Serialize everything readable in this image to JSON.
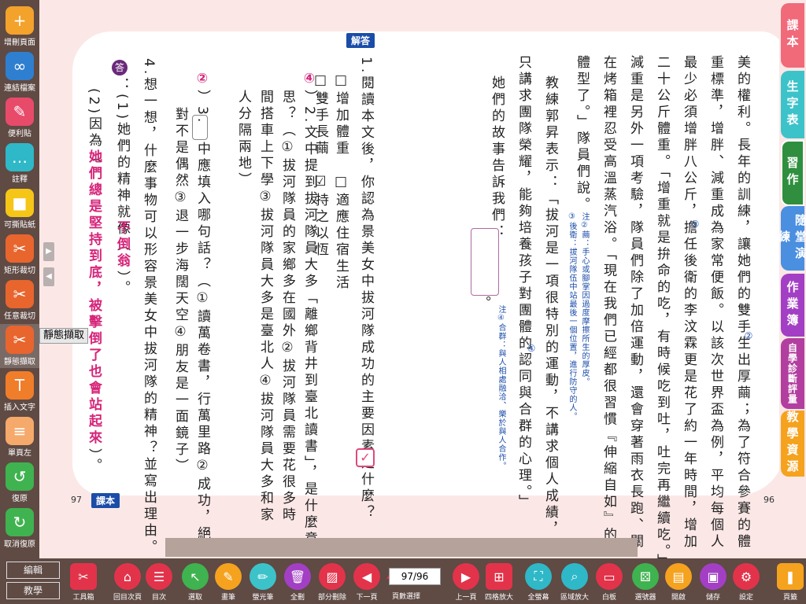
{
  "left_toolbar": [
    {
      "label": "增刪頁面",
      "icon": "add-page-icon",
      "color": "#f3a22b"
    },
    {
      "label": "連結檔案",
      "icon": "link-icon",
      "color": "#2f7fd0"
    },
    {
      "label": "便利貼",
      "icon": "sticky-note-icon",
      "color": "#e84a6a"
    },
    {
      "label": "註釋",
      "icon": "comment-icon",
      "color": "#2fb8c7"
    },
    {
      "label": "可撕貼紙",
      "icon": "sticker-icon",
      "color": "#f5c518"
    },
    {
      "label": "矩形裁切",
      "icon": "rect-crop-icon",
      "color": "#e8652e"
    },
    {
      "label": "任意裁切",
      "icon": "free-crop-icon",
      "color": "#e8652e"
    },
    {
      "label": "靜態擷取",
      "icon": "static-capture-icon",
      "color": "#e8652e"
    },
    {
      "label": "插入文字",
      "icon": "insert-text-icon",
      "color": "#f07d2a"
    },
    {
      "label": "單頁左",
      "icon": "single-page-left-icon",
      "color": "#f5a96a"
    },
    {
      "label": "復原",
      "icon": "undo-icon",
      "color": "#3fb34f"
    },
    {
      "label": "取消復原",
      "icon": "redo-icon",
      "color": "#3fb34f"
    }
  ],
  "tooltip": "靜態擷取",
  "page": {
    "answer_tag": "解答",
    "left_page_number": "97",
    "left_tag": "課本",
    "right_page_number": "96"
  },
  "right_text": [
    "美的權利。長年的訓練，讓她們的雙手生出厚繭；為了符合參賽的體",
    "重標準，增胖、減重成為家常便飯。以該次世界盃為例，平均每個人",
    "最少必須增胖八公斤，擔任後衛的李汶霖更是花了約一年時間，增加",
    "二十公斤體重。「增重就是拚命的吃，有時候吃到吐，吐完再繼續吃。」",
    "減重是另外一項考驗，隊員們除了加倍運動，還會穿著雨衣長跑、關",
    "在烤箱裡忍受高溫蒸汽浴。「現在我們已經都很習慣『伸縮自如』的",
    "體型了。」隊員們說。",
    "教練郭昇表示：「拔河是一項很特別的運動，不講求個人成績，",
    "只講求團隊榮耀，能夠培養孩子對團體的認同與合群的心理。」",
    "她們的故事告訴我們："
  ],
  "notes": [
    "注②繭：手心或腳掌因過度摩擦所生的厚皮。",
    "③後衛：拔河隊伍中站最後一個位置，進行防守的人。",
    "注④合群：與人相處融洽、樂於與人合作。"
  ],
  "note_markers": {
    "n2": "②",
    "n3": "③",
    "n4": "④"
  },
  "right_last_end": "。",
  "questions": {
    "q1": "1.閱讀本文後，你認為景美女中拔河隊成功的主要因素是什麼？",
    "q1_opts": [
      "□增加體重　□適應住宿生活",
      "□雙手長繭　☑持之以恆"
    ],
    "q2_ans": "④",
    "q2": "）2.文中提到拔河隊員大多「離鄉背井到臺北讀書」，是什麼意",
    "q2_cont": "思？（①拔河隊員的家鄉多在國外②拔河隊員需要花很多時",
    "q2_cont2": "間搭車上下學③拔河隊員大多是臺北人④拔河隊員大多和家",
    "q2_cont3": "人分隔兩地）",
    "q3_ans": "②",
    "q3": "）3.",
    "q3_body": "中應填入哪句話？（①讀萬卷書，行萬里路②成功，絕",
    "q3_cont": "對不是偶然③退一步海闊天空④朋友是一面鏡子）",
    "q4": "4.想一想，什麼事物可以形容景美女中拔河隊的精神？並寫出理由。",
    "ans_badge": "答",
    "a1": "：(1)她們的精神就像（",
    "a1_ans": "不倒翁",
    "a1_end": "）。",
    "a2": "(2)因為（",
    "a2_ans": "她們總是堅持到底，被擊倒了也會站起來",
    "a2_end": "）。"
  },
  "right_tabs": [
    {
      "label": "課本",
      "color": "#f06a7a"
    },
    {
      "label": "生字表",
      "color": "#3cc3c9"
    },
    {
      "label": "習作",
      "color": "#2f8f3f"
    },
    {
      "label": "隨堂演練",
      "color": "#4a8fe0"
    },
    {
      "label": "作業簿",
      "color": "#a33fc4"
    },
    {
      "label": "自學診斷評量",
      "color": "#b23fa0"
    },
    {
      "label": "教學資源",
      "color": "#f5a21e"
    }
  ],
  "bottom_modes": [
    "編輯",
    "教學"
  ],
  "bottom_tools": [
    {
      "label": "工具箱",
      "icon": "toolbox-icon",
      "color": "#e2334a"
    },
    {
      "label": "回目次頁",
      "icon": "home-icon",
      "color": "#e2334a"
    },
    {
      "label": "目次",
      "icon": "toc-icon",
      "color": "#e2334a"
    },
    {
      "label": "選取",
      "icon": "select-icon",
      "color": "#3fb34f"
    },
    {
      "label": "畫筆",
      "icon": "pen-icon",
      "color": "#f5a21e"
    },
    {
      "label": "螢光筆",
      "icon": "highlighter-icon",
      "color": "#3cc3c9"
    },
    {
      "label": "全刪",
      "icon": "trash-icon",
      "color": "#a33fc4"
    },
    {
      "label": "部分刪除",
      "icon": "eraser-icon",
      "color": "#e2334a"
    },
    {
      "label": "下一頁",
      "icon": "prev-arrow-icon",
      "color": "#e2334a"
    },
    {
      "label": "上一頁",
      "icon": "next-arrow-icon",
      "color": "#e2334a"
    },
    {
      "label": "四格放大",
      "icon": "grid-zoom-icon",
      "color": "#e2334a"
    },
    {
      "label": "全螢幕",
      "icon": "fullscreen-icon",
      "color": "#2fb8c7"
    },
    {
      "label": "區域放大",
      "icon": "magnify-icon",
      "color": "#2fb8c7"
    },
    {
      "label": "白板",
      "icon": "whiteboard-icon",
      "color": "#e2334a"
    },
    {
      "label": "選號器",
      "icon": "number-picker-icon",
      "color": "#3fb34f"
    },
    {
      "label": "開啟",
      "icon": "open-folder-icon",
      "color": "#f5a21e"
    },
    {
      "label": "儲存",
      "icon": "save-icon",
      "color": "#a33fc4"
    },
    {
      "label": "設定",
      "icon": "gear-icon",
      "color": "#e2334a"
    },
    {
      "label": "頁籤",
      "icon": "bookmark-icon",
      "color": "#f5a21e"
    }
  ],
  "page_field": {
    "value": "97/96",
    "label": "頁數選擇"
  }
}
